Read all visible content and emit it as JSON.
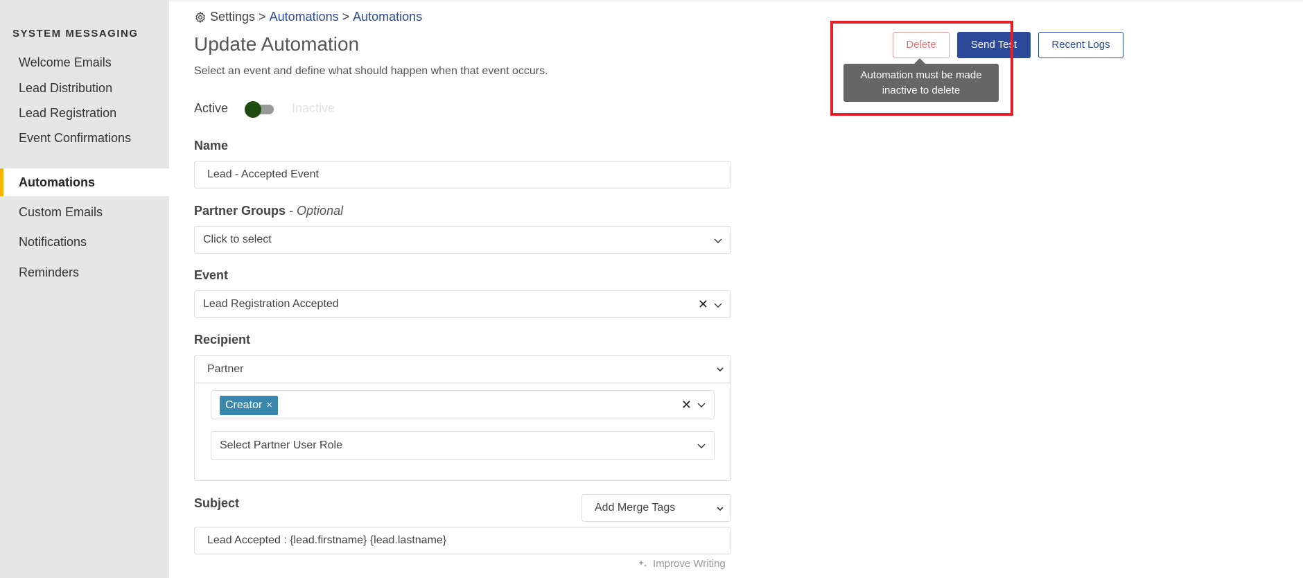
{
  "sidebar": {
    "heading": "SYSTEM MESSAGING",
    "items": [
      {
        "label": "Welcome Emails"
      },
      {
        "label": "Lead Distribution"
      },
      {
        "label": "Lead Registration"
      },
      {
        "label": "Event Confirmations"
      },
      {
        "label": "Automations",
        "active": true
      },
      {
        "label": "Custom Emails"
      },
      {
        "label": "Notifications"
      },
      {
        "label": "Reminders"
      }
    ]
  },
  "breadcrumb": {
    "root": "Settings",
    "sep": ">",
    "level1": "Automations",
    "level2": "Automations"
  },
  "page": {
    "title": "Update Automation",
    "description": "Select an event and define what should happen when that event occurs."
  },
  "status": {
    "active_label": "Active",
    "inactive_label": "Inactive"
  },
  "header_buttons": {
    "delete": "Delete",
    "send_test": "Send Test",
    "recent_logs": "Recent Logs",
    "tooltip": "Automation must be made inactive to delete"
  },
  "form": {
    "name_label": "Name",
    "name_value": "Lead - Accepted Event",
    "partner_groups_label": "Partner Groups",
    "partner_groups_optional": "- Optional",
    "partner_groups_placeholder": "Click to select",
    "event_label": "Event",
    "event_value": "Lead Registration Accepted",
    "recipient_label": "Recipient",
    "recipient_value": "Partner",
    "recipient_tag": "Creator",
    "partner_role_placeholder": "Select Partner User Role",
    "subject_label": "Subject",
    "merge_tags": "Add Merge Tags",
    "subject_value": "Lead Accepted : {lead.firstname} {lead.lastname}",
    "improve_writing": "Improve Writing"
  },
  "colors": {
    "accent": "#2c4a99",
    "active_indicator": "#f5b500",
    "delete": "#e57373",
    "highlight": "#e32027"
  }
}
